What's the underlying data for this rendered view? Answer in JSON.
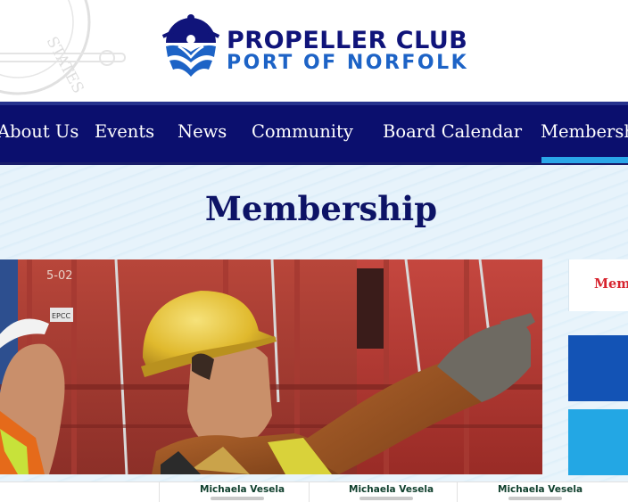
{
  "logo": {
    "line1": "PROPELLER CLUB",
    "line2": "PORT OF NORFOLK",
    "seal_text": "STATES",
    "icon": "ship-wheel-waves-logo-icon"
  },
  "nav": {
    "items": [
      {
        "label": "About Us"
      },
      {
        "label": "Events"
      },
      {
        "label": "News"
      },
      {
        "label": "Community"
      },
      {
        "label": "Board Calendar"
      },
      {
        "label": "Membership",
        "active": true
      }
    ]
  },
  "page": {
    "title": "Membership"
  },
  "hero": {
    "image": "port-workers-hardhats-containers-photo",
    "container_markings": [
      "5-02",
      "EPCC"
    ]
  },
  "sidebar": {
    "card_label": "Mem"
  },
  "members": [
    {
      "name": "Michaela Vesela"
    },
    {
      "name": "Michaela Vesela"
    },
    {
      "name": "Michaela Vesela"
    }
  ],
  "colors": {
    "navy": "#0b0f6e",
    "accent_blue": "#2aa6e8",
    "title": "#0d1366",
    "red": "#d7232e"
  }
}
